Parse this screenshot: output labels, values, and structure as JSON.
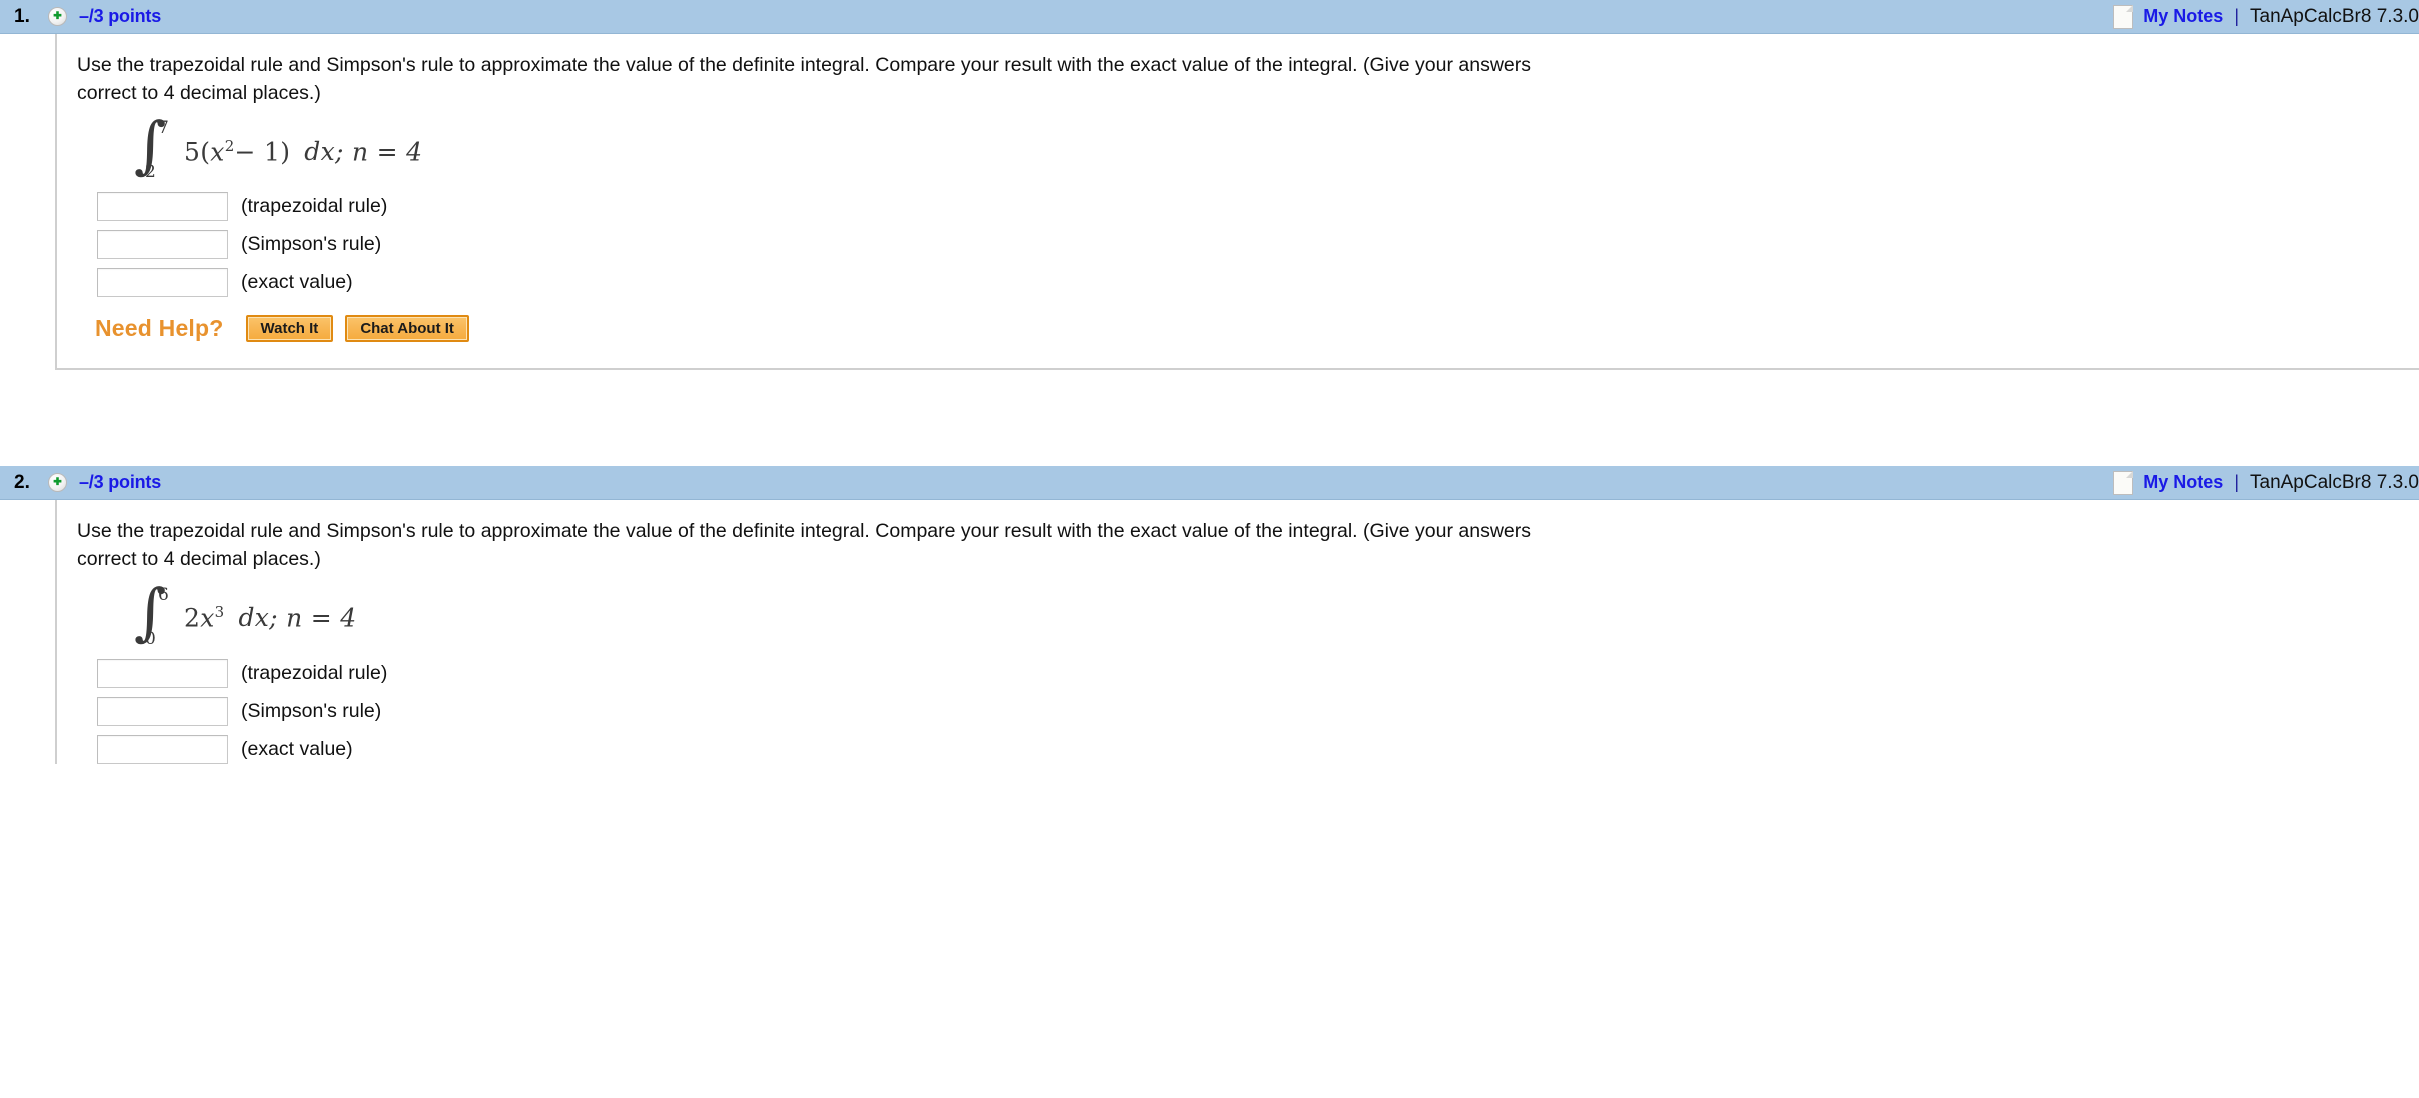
{
  "page": {
    "background": "#ffffff",
    "header_bg": "#a8c8e4",
    "accent_blue": "#1a1ae6",
    "accent_orange": "#e8922e",
    "button_orange": "#f8b755"
  },
  "questions": [
    {
      "number": "1.",
      "plus_icon": "plus-circle-icon",
      "points": "–/3 points",
      "notes_icon": "note-page-icon",
      "notes_label": "My Notes",
      "separator": "|",
      "book_code": "TanApCalcBr8 7.3.0",
      "prompt_line1": "Use the trapezoidal rule and Simpson's rule to approximate the value of the definite integral. Compare your result with the exact value of the integral. (Give your answers",
      "prompt_line2": "correct to 4 decimal places.)",
      "math": {
        "integral_symbol": "∫",
        "upper_limit": "7",
        "lower_limit": "2",
        "integrand_coefficient": "5",
        "integrand_open": "(",
        "integrand_variable": "x",
        "integrand_exponent": "2",
        "integrand_minus": "− 1",
        "integrand_close": ")",
        "differential": "dx;",
        "n_label": "n = 4",
        "plain": "∫ from 2 to 7 of 5(x² − 1) dx; n = 4"
      },
      "answers": [
        {
          "value": "",
          "placeholder": "",
          "label": "(trapezoidal rule)"
        },
        {
          "value": "",
          "placeholder": "",
          "label": "(Simpson's rule)"
        },
        {
          "value": "",
          "placeholder": "",
          "label": "(exact value)"
        }
      ],
      "need_help": {
        "label": "Need Help?",
        "buttons": [
          "Watch It",
          "Chat About It"
        ]
      }
    },
    {
      "number": "2.",
      "plus_icon": "plus-circle-icon",
      "points": "–/3 points",
      "notes_icon": "note-page-icon",
      "notes_label": "My Notes",
      "separator": "|",
      "book_code": "TanApCalcBr8 7.3.0",
      "prompt_line1": "Use the trapezoidal rule and Simpson's rule to approximate the value of the definite integral. Compare your result with the exact value of the integral. (Give your answers",
      "prompt_line2": "correct to 4 decimal places.)",
      "math": {
        "integral_symbol": "∫",
        "upper_limit": "6",
        "lower_limit": "0",
        "integrand_coefficient": "2",
        "integrand_open": "",
        "integrand_variable": "x",
        "integrand_exponent": "3",
        "integrand_minus": "",
        "integrand_close": "",
        "differential": "dx;",
        "n_label": "n = 4",
        "plain": "∫ from 0 to 6 of 2x³ dx; n = 4"
      },
      "answers": [
        {
          "value": "",
          "placeholder": "",
          "label": "(trapezoidal rule)"
        },
        {
          "value": "",
          "placeholder": "",
          "label": "(Simpson's rule)"
        },
        {
          "value": "",
          "placeholder": "",
          "label": "(exact value)"
        }
      ]
    }
  ]
}
